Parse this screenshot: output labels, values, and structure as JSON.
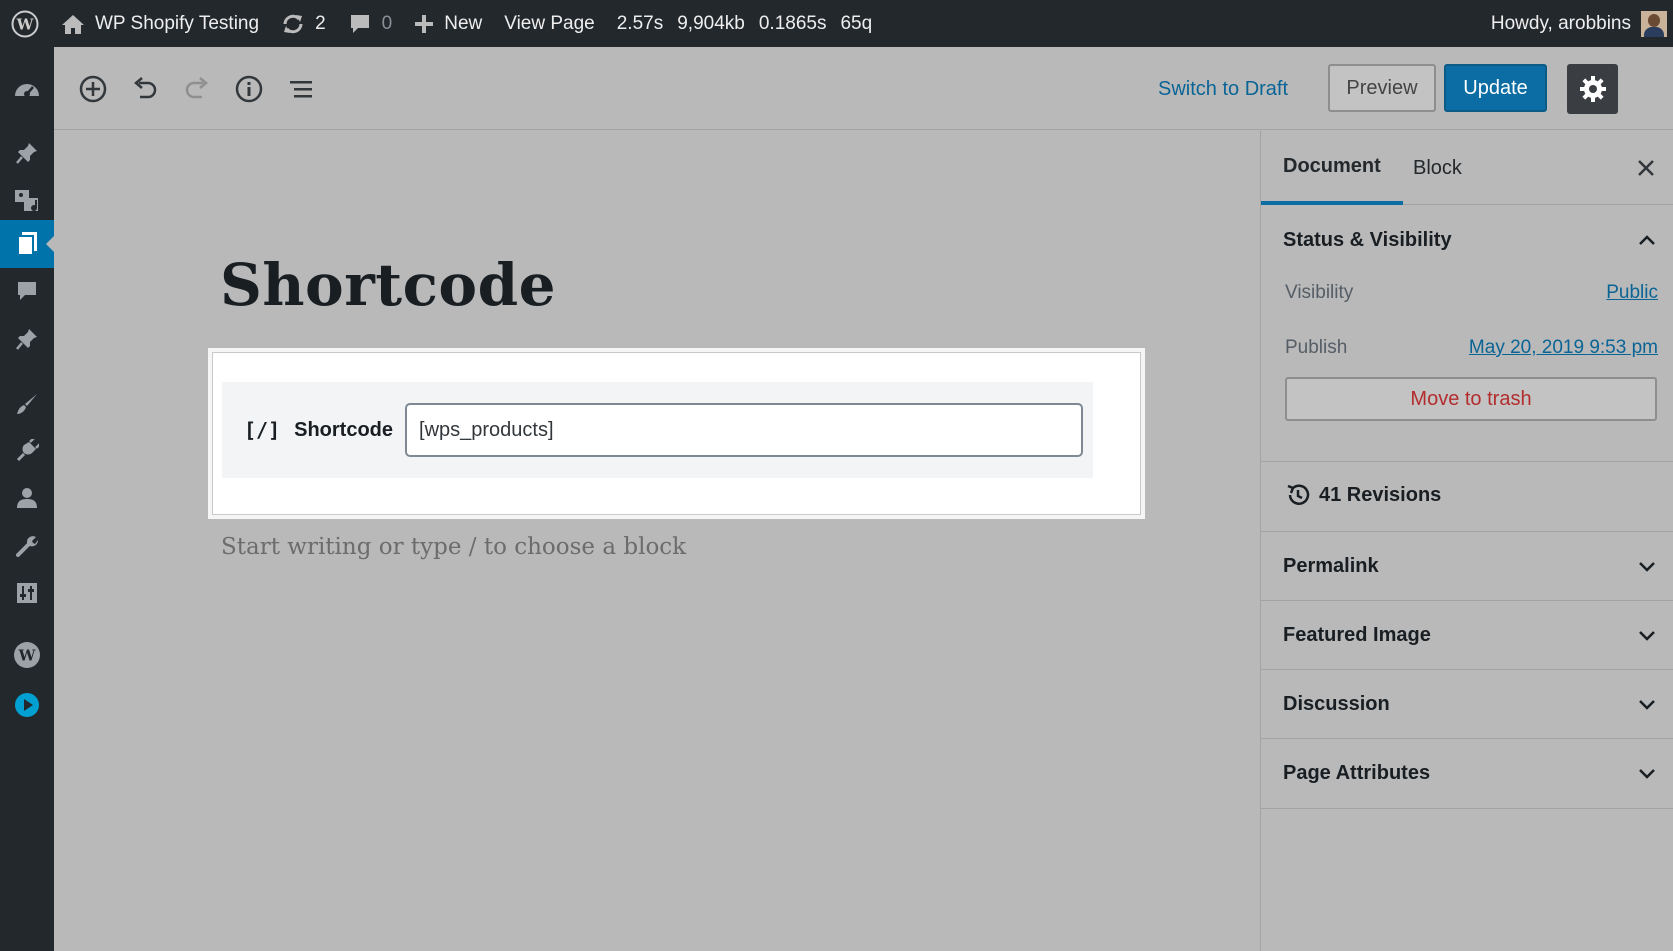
{
  "admin_bar": {
    "site_name": "WP Shopify Testing",
    "updates_count": "2",
    "comments_count": "0",
    "new_label": "New",
    "view_page_label": "View Page",
    "metrics": [
      "2.57s",
      "9,904kb",
      "0.1865s",
      "65q"
    ],
    "greeting": "Howdy, arobbins"
  },
  "toolbar": {
    "switch_to_draft": "Switch to Draft",
    "preview": "Preview",
    "update": "Update"
  },
  "editor": {
    "title": "Shortcode",
    "block": {
      "icon_text": "[/]",
      "label": "Shortcode",
      "value": "[wps_products]"
    },
    "appender_placeholder": "Start writing or type / to choose a block"
  },
  "panel": {
    "tabs": [
      "Document",
      "Block"
    ],
    "status_visibility": {
      "title": "Status & Visibility",
      "visibility_label": "Visibility",
      "visibility_value": "Public",
      "publish_label": "Publish",
      "publish_value": "May 20, 2019 9:53 pm",
      "trash_label": "Move to trash"
    },
    "revisions": "41 Revisions",
    "sections": [
      "Permalink",
      "Featured Image",
      "Discussion",
      "Page Attributes"
    ]
  },
  "colors": {
    "accent": "#0b6da3",
    "admin_bar": "#23282d",
    "trash": "#b32d2e"
  }
}
